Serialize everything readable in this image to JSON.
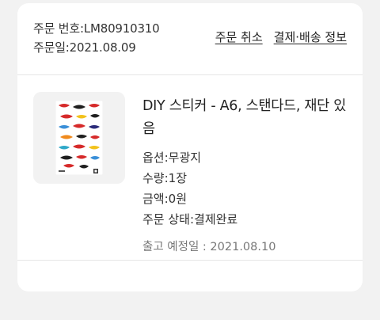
{
  "order": {
    "number_text": "주문 번호:LM80910310",
    "date_text": "주문일:2021.08.09",
    "cancel_label": "주문 취소",
    "payment_label": "결제·배송 정보"
  },
  "item": {
    "title": "DIY 스티커 - A6, 스탠다드, 재단 있음",
    "options": [
      "옵션:무광지",
      "수량:1장",
      "금액:0원",
      "주문 상태:결제완료"
    ],
    "ship_date_text": "출고 예정일 : 2021.08.10",
    "thumbnail_icon": "sticker-sheet-image"
  },
  "colors": {
    "background": "#f2f2f2",
    "card": "#ffffff",
    "divider": "#e6e6e6"
  }
}
